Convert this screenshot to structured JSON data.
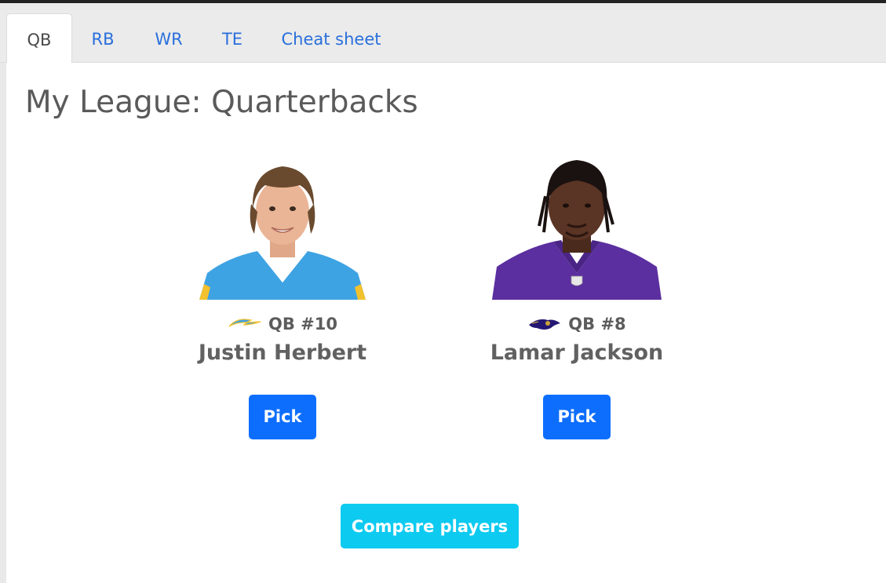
{
  "tabs": [
    {
      "label": "QB",
      "active": true
    },
    {
      "label": "RB",
      "active": false
    },
    {
      "label": "WR",
      "active": false
    },
    {
      "label": "TE",
      "active": false
    },
    {
      "label": "Cheat sheet",
      "active": false
    }
  ],
  "page": {
    "title": "My League: Quarterbacks"
  },
  "players": [
    {
      "name": "Justin Herbert",
      "position_rank": "QB #10",
      "team_logo_icon": "chargers-bolt-icon",
      "jersey_color": "#3b9fe0",
      "pick_label": "Pick"
    },
    {
      "name": "Lamar Jackson",
      "position_rank": "QB #8",
      "team_logo_icon": "ravens-logo-icon",
      "jersey_color": "#5a2f9e",
      "pick_label": "Pick"
    }
  ],
  "compare": {
    "label": "Compare players"
  },
  "colors": {
    "primary": "#0d6efd",
    "info": "#0dcaf0",
    "link": "#2a6fdb"
  }
}
